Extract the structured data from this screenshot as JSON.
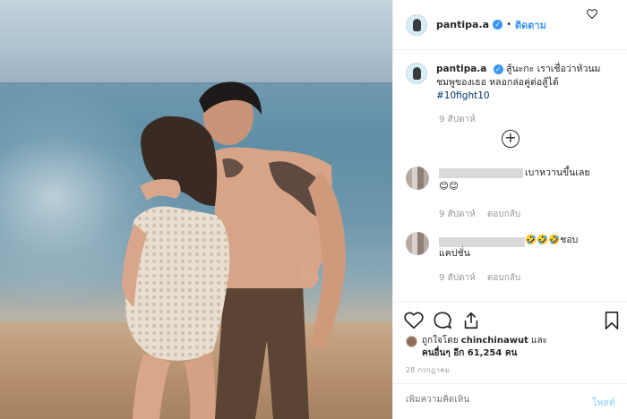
{
  "post": {
    "author": "pantipa.a",
    "follow_label": "ติดตาม",
    "separator": "•",
    "caption": {
      "username": "pantipa.a",
      "text": "สู้นะกะ เราเชื่อว่าหัวนมชมพูของเธอ หลอกล่อคู่ต่อสู้ได้",
      "hashtag": "#10fight10",
      "time": "9 สัปดาห์"
    },
    "comments": [
      {
        "text": "เบาหวานขึ้นเลย 😊😊",
        "time": "9 สัปดาห์",
        "reply": "ตอบกลับ"
      },
      {
        "text": "🤣🤣🤣ชอบแคปชั่น",
        "time": "9 สัปดาห์",
        "reply": "ตอบกลับ"
      }
    ],
    "likes": {
      "prefix": "ถูกใจโดย",
      "user": "chinchinawut",
      "and": "และ",
      "others": "คนอื่นๆ อีก 61,254 คน"
    },
    "date": "28 กรกฎาคม",
    "add_comment_placeholder": "เพิ่มความคิดเห็น",
    "post_button": "โพสต์"
  },
  "icons": {
    "verified": "verified-badge-icon",
    "load_more": "plus-circle-icon",
    "like": "heart-icon",
    "comment": "comment-bubble-icon",
    "share": "share-icon",
    "save": "bookmark-icon"
  },
  "colors": {
    "accent": "#3897f0",
    "muted": "#999999",
    "border": "#efefef",
    "hashtag": "#003569"
  }
}
